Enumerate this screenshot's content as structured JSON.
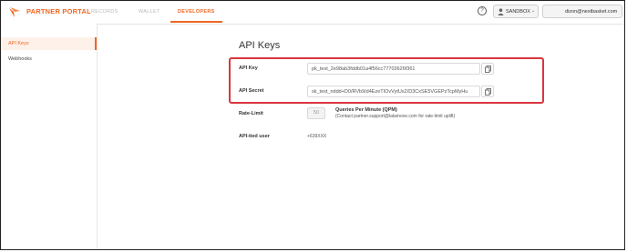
{
  "header": {
    "brand": "PARTNER PORTAL",
    "tabs": [
      {
        "label": "RECORDS",
        "active": false
      },
      {
        "label": "WALLET",
        "active": false
      },
      {
        "label": "DEVELOPERS",
        "active": true
      }
    ],
    "help_glyph": "?",
    "environment": "SANDBOX",
    "user_email": "dizon@nextbasket.com"
  },
  "sidebar": {
    "items": [
      {
        "label": "API Keys",
        "active": true
      },
      {
        "label": "Webhooks",
        "active": false
      }
    ]
  },
  "main": {
    "title": "API Keys",
    "api_key": {
      "label": "API Key",
      "value": "pk_test_2e98ab3fddb01a4f56cc77703626f361"
    },
    "api_secret": {
      "label": "API Secret",
      "value": "sk_test_nddd+D0/RVb9/d4EzeTIOvVytUs2/D3CxSE5VGEPzTcpMyHu"
    },
    "rate_limit": {
      "label": "Rate-Limit",
      "value": "50",
      "unit_title": "Queries Per Minute (QPM)",
      "note": "(Contact partner.support@lalamove.com for rate-limit uplift)"
    },
    "api_tied_user": {
      "label": "API-tied user",
      "value": "+639XXX"
    }
  },
  "colors": {
    "accent": "#f16622",
    "highlight_border": "#d9363e"
  },
  "icons": [
    "logo-icon",
    "help-icon",
    "user-icon",
    "chevron-down-icon",
    "avatar-icon",
    "copy-icon"
  ]
}
